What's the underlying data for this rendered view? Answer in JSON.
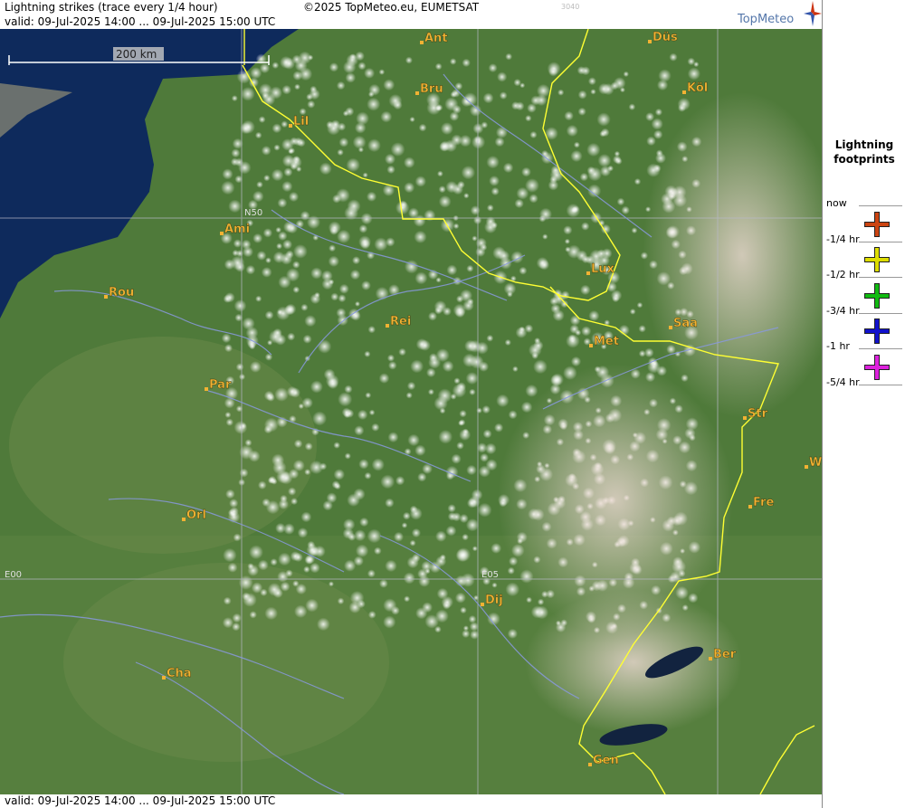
{
  "header": {
    "title": "Lightning strikes (trace every 1/4 hour)",
    "copyright": "©2025 TopMeteo.eu, EUMETSAT",
    "code": "3040",
    "valid": "valid:  09-Jul-2025 14:00 ... 09-Jul-2025 15:00 UTC",
    "logo": "TopMeteo"
  },
  "footer": {
    "valid": "valid:  09-Jul-2025 14:00 ... 09-Jul-2025 15:00 UTC"
  },
  "map": {
    "scale_label": "200 km",
    "grid_labels": {
      "n50": "N50",
      "e00": "E00",
      "e05": "E05"
    },
    "cities": [
      {
        "name": "Ant"
      },
      {
        "name": "Düs"
      },
      {
        "name": "Bru"
      },
      {
        "name": "Köl"
      },
      {
        "name": "Lil"
      },
      {
        "name": "Ami"
      },
      {
        "name": "Rou"
      },
      {
        "name": "Lux"
      },
      {
        "name": "Rei"
      },
      {
        "name": "Saa"
      },
      {
        "name": "Met"
      },
      {
        "name": "Par"
      },
      {
        "name": "Str"
      },
      {
        "name": "W"
      },
      {
        "name": "Fre"
      },
      {
        "name": "Orl"
      },
      {
        "name": "Dij"
      },
      {
        "name": "Ber"
      },
      {
        "name": "Cha"
      },
      {
        "name": "Gen"
      }
    ]
  },
  "legend": {
    "title_line1": "Lightning",
    "title_line2": "footprints",
    "items": [
      {
        "label": "now",
        "color": ""
      },
      {
        "label": "-1/4 hr",
        "color": "#cc4411"
      },
      {
        "label": "-1/2 hr",
        "color": "#dddd00"
      },
      {
        "label": "-3/4 hr",
        "color": "#11bb11"
      },
      {
        "label": "-1 hr",
        "color": "#1111cc"
      },
      {
        "label": "-5/4 hr",
        "color": "#dd22dd"
      }
    ]
  },
  "colors": {
    "city_label": "#f2b233",
    "border": "#ffff33",
    "river": "#8899dd",
    "sea": "#0e2a5c"
  }
}
